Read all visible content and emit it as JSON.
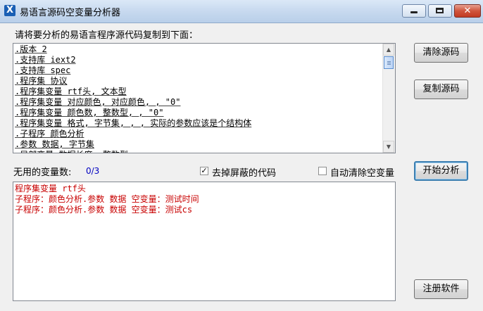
{
  "window": {
    "title": "易语言源码空变量分析器",
    "app_icon_letter": "X",
    "close_glyph": "✕"
  },
  "source": {
    "label": "请将要分析的易语言程序源代码复制到下面：",
    "lines": [
      ".版本 2",
      ".支持库 iext2",
      ".支持库 spec",
      ".程序集 协议",
      ".程序集变量 rtf头, 文本型",
      ".程序集变量 对应颜色, 对应颜色, , \"0\"",
      ".程序集变量 颜色数, 整数型, , \"0\"",
      ".程序集变量 格式, 字节集, , , 实际的参数应该是个结构体",
      ".子程序 颜色分析",
      ".参数 数据, 字节集",
      ".局部变量 数据长度, 整数型"
    ]
  },
  "buttons": {
    "clear_source": "清除源码",
    "copy_source": "复制源码",
    "start_analysis": "开始分析",
    "register": "注册软件"
  },
  "stats": {
    "unused_label": "无用的变量数:",
    "unused_count": "0/3"
  },
  "options": {
    "remove_masked": {
      "label": "去掉屏蔽的代码",
      "checked": true,
      "mark": "✓"
    },
    "auto_clear_empty": {
      "label": "自动清除空变量",
      "checked": false,
      "mark": ""
    }
  },
  "results": {
    "lines": [
      "程序集变量 rtf头",
      "子程序：颜色分析.参数 数据 空变量：测试时间",
      "子程序：颜色分析.参数 数据 空变量：测试cs"
    ],
    "color": "#c80000"
  },
  "icons": {
    "scroll_up": "▲",
    "scroll_down": "▼"
  }
}
